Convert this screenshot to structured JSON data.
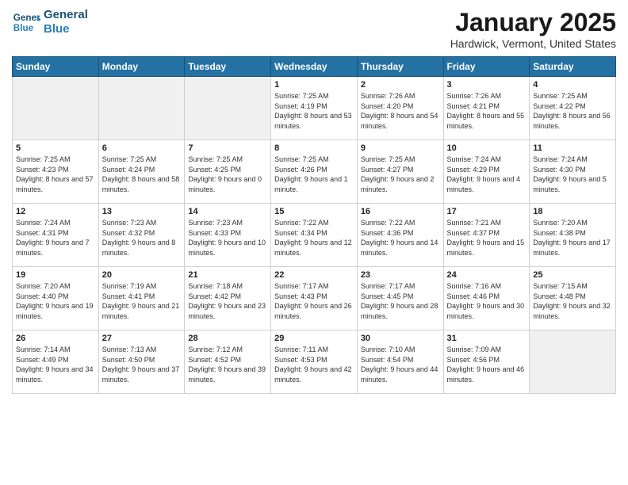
{
  "logo": {
    "line1": "General",
    "line2": "Blue"
  },
  "title": "January 2025",
  "location": "Hardwick, Vermont, United States",
  "days_of_week": [
    "Sunday",
    "Monday",
    "Tuesday",
    "Wednesday",
    "Thursday",
    "Friday",
    "Saturday"
  ],
  "weeks": [
    [
      {
        "num": "",
        "empty": true
      },
      {
        "num": "",
        "empty": true
      },
      {
        "num": "",
        "empty": true
      },
      {
        "num": "1",
        "sunrise": "7:25 AM",
        "sunset": "4:19 PM",
        "daylight": "8 hours and 53 minutes."
      },
      {
        "num": "2",
        "sunrise": "7:26 AM",
        "sunset": "4:20 PM",
        "daylight": "8 hours and 54 minutes."
      },
      {
        "num": "3",
        "sunrise": "7:26 AM",
        "sunset": "4:21 PM",
        "daylight": "8 hours and 55 minutes."
      },
      {
        "num": "4",
        "sunrise": "7:25 AM",
        "sunset": "4:22 PM",
        "daylight": "8 hours and 56 minutes."
      }
    ],
    [
      {
        "num": "5",
        "sunrise": "7:25 AM",
        "sunset": "4:23 PM",
        "daylight": "8 hours and 57 minutes."
      },
      {
        "num": "6",
        "sunrise": "7:25 AM",
        "sunset": "4:24 PM",
        "daylight": "8 hours and 58 minutes."
      },
      {
        "num": "7",
        "sunrise": "7:25 AM",
        "sunset": "4:25 PM",
        "daylight": "9 hours and 0 minutes."
      },
      {
        "num": "8",
        "sunrise": "7:25 AM",
        "sunset": "4:26 PM",
        "daylight": "9 hours and 1 minute."
      },
      {
        "num": "9",
        "sunrise": "7:25 AM",
        "sunset": "4:27 PM",
        "daylight": "9 hours and 2 minutes."
      },
      {
        "num": "10",
        "sunrise": "7:24 AM",
        "sunset": "4:29 PM",
        "daylight": "9 hours and 4 minutes."
      },
      {
        "num": "11",
        "sunrise": "7:24 AM",
        "sunset": "4:30 PM",
        "daylight": "9 hours and 5 minutes."
      }
    ],
    [
      {
        "num": "12",
        "sunrise": "7:24 AM",
        "sunset": "4:31 PM",
        "daylight": "9 hours and 7 minutes."
      },
      {
        "num": "13",
        "sunrise": "7:23 AM",
        "sunset": "4:32 PM",
        "daylight": "9 hours and 8 minutes."
      },
      {
        "num": "14",
        "sunrise": "7:23 AM",
        "sunset": "4:33 PM",
        "daylight": "9 hours and 10 minutes."
      },
      {
        "num": "15",
        "sunrise": "7:22 AM",
        "sunset": "4:34 PM",
        "daylight": "9 hours and 12 minutes."
      },
      {
        "num": "16",
        "sunrise": "7:22 AM",
        "sunset": "4:36 PM",
        "daylight": "9 hours and 14 minutes."
      },
      {
        "num": "17",
        "sunrise": "7:21 AM",
        "sunset": "4:37 PM",
        "daylight": "9 hours and 15 minutes."
      },
      {
        "num": "18",
        "sunrise": "7:20 AM",
        "sunset": "4:38 PM",
        "daylight": "9 hours and 17 minutes."
      }
    ],
    [
      {
        "num": "19",
        "sunrise": "7:20 AM",
        "sunset": "4:40 PM",
        "daylight": "9 hours and 19 minutes."
      },
      {
        "num": "20",
        "sunrise": "7:19 AM",
        "sunset": "4:41 PM",
        "daylight": "9 hours and 21 minutes."
      },
      {
        "num": "21",
        "sunrise": "7:18 AM",
        "sunset": "4:42 PM",
        "daylight": "9 hours and 23 minutes."
      },
      {
        "num": "22",
        "sunrise": "7:17 AM",
        "sunset": "4:43 PM",
        "daylight": "9 hours and 26 minutes."
      },
      {
        "num": "23",
        "sunrise": "7:17 AM",
        "sunset": "4:45 PM",
        "daylight": "9 hours and 28 minutes."
      },
      {
        "num": "24",
        "sunrise": "7:16 AM",
        "sunset": "4:46 PM",
        "daylight": "9 hours and 30 minutes."
      },
      {
        "num": "25",
        "sunrise": "7:15 AM",
        "sunset": "4:48 PM",
        "daylight": "9 hours and 32 minutes."
      }
    ],
    [
      {
        "num": "26",
        "sunrise": "7:14 AM",
        "sunset": "4:49 PM",
        "daylight": "9 hours and 34 minutes."
      },
      {
        "num": "27",
        "sunrise": "7:13 AM",
        "sunset": "4:50 PM",
        "daylight": "9 hours and 37 minutes."
      },
      {
        "num": "28",
        "sunrise": "7:12 AM",
        "sunset": "4:52 PM",
        "daylight": "9 hours and 39 minutes."
      },
      {
        "num": "29",
        "sunrise": "7:11 AM",
        "sunset": "4:53 PM",
        "daylight": "9 hours and 42 minutes."
      },
      {
        "num": "30",
        "sunrise": "7:10 AM",
        "sunset": "4:54 PM",
        "daylight": "9 hours and 44 minutes."
      },
      {
        "num": "31",
        "sunrise": "7:09 AM",
        "sunset": "4:56 PM",
        "daylight": "9 hours and 46 minutes."
      },
      {
        "num": "",
        "empty": true
      }
    ]
  ]
}
